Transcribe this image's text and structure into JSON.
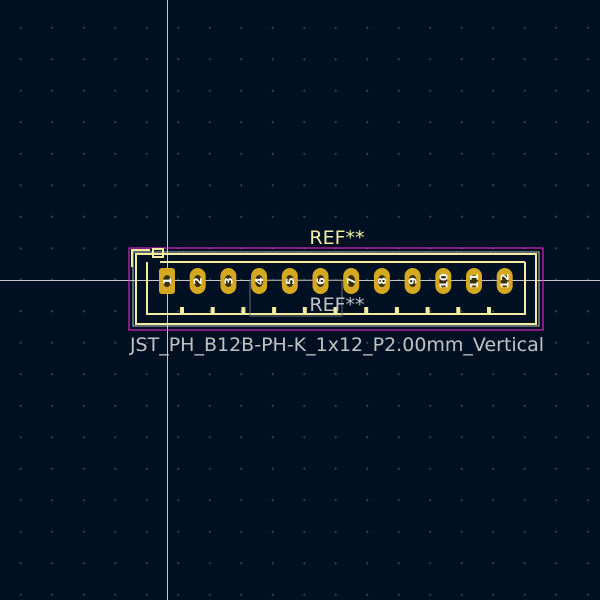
{
  "footprint": {
    "reference": "REF**",
    "value": "REF**",
    "name": "JST_PH_B12B-PH-K_1x12_P2.00mm_Vertical",
    "pads": [
      "1",
      "2",
      "3",
      "4",
      "5",
      "6",
      "7",
      "8",
      "9",
      "10",
      "11",
      "12"
    ]
  },
  "colors": {
    "background": "#001023",
    "grid": "#3a4658",
    "crosshair": "#c8c8c8",
    "courtyard": "#ff26e2",
    "silkscreen": "#f2eda1",
    "fab": "#c2c2c2",
    "pad": "#d4a91f"
  }
}
